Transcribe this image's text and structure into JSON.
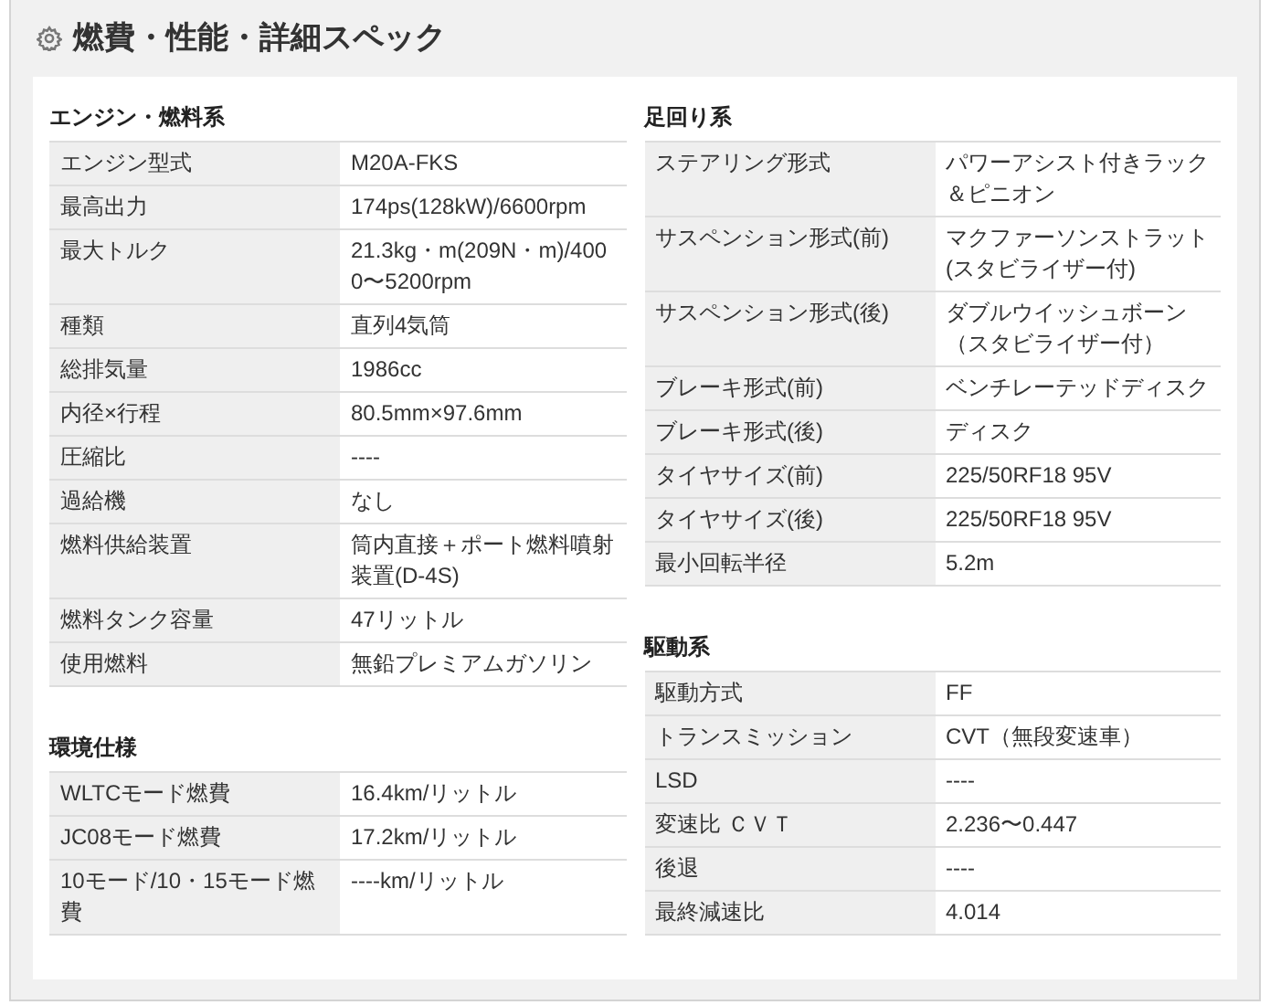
{
  "title": "燃費・性能・詳細スペック",
  "columns": [
    {
      "sections": [
        {
          "heading": "エンジン・燃料系",
          "rows": [
            {
              "label": "エンジン型式",
              "value": "M20A-FKS"
            },
            {
              "label": "最高出力",
              "value": "174ps(128kW)/6600rpm"
            },
            {
              "label": "最大トルク",
              "value": "21.3kg・m(209N・m)/4000〜5200rpm"
            },
            {
              "label": "種類",
              "value": "直列4気筒"
            },
            {
              "label": "総排気量",
              "value": "1986cc"
            },
            {
              "label": "内径×行程",
              "value": "80.5mm×97.6mm"
            },
            {
              "label": "圧縮比",
              "value": "----"
            },
            {
              "label": "過給機",
              "value": "なし"
            },
            {
              "label": "燃料供給装置",
              "value": "筒内直接＋ポート燃料噴射装置(D-4S)"
            },
            {
              "label": "燃料タンク容量",
              "value": "47リットル"
            },
            {
              "label": "使用燃料",
              "value": "無鉛プレミアムガソリン"
            }
          ]
        },
        {
          "heading": "環境仕様",
          "rows": [
            {
              "label": "WLTCモード燃費",
              "value": "16.4km/リットル"
            },
            {
              "label": "JC08モード燃費",
              "value": "17.2km/リットル"
            },
            {
              "label": "10モード/10・15モード燃費",
              "value": "----km/リットル"
            }
          ]
        }
      ]
    },
    {
      "sections": [
        {
          "heading": "足回り系",
          "rows": [
            {
              "label": "ステアリング形式",
              "value": "パワーアシスト付きラック＆ピニオン"
            },
            {
              "label": "サスペンション形式(前)",
              "value": "マクファーソンストラット(スタビライザー付)"
            },
            {
              "label": "サスペンション形式(後)",
              "value": "ダブルウイッシュボーン（スタビライザー付）"
            },
            {
              "label": "ブレーキ形式(前)",
              "value": "ベンチレーテッドディスク"
            },
            {
              "label": "ブレーキ形式(後)",
              "value": "ディスク"
            },
            {
              "label": "タイヤサイズ(前)",
              "value": "225/50RF18 95V"
            },
            {
              "label": "タイヤサイズ(後)",
              "value": "225/50RF18 95V"
            },
            {
              "label": "最小回転半径",
              "value": "5.2m"
            }
          ]
        },
        {
          "heading": "駆動系",
          "rows": [
            {
              "label": "駆動方式",
              "value": "FF"
            },
            {
              "label": "トランスミッション",
              "value": "CVT（無段変速車）"
            },
            {
              "label": "LSD",
              "value": "----"
            },
            {
              "label": "変速比 ＣＶＴ",
              "value": "2.236〜0.447"
            },
            {
              "label": "後退",
              "value": "----"
            },
            {
              "label": "最終減速比",
              "value": "4.014"
            }
          ]
        }
      ]
    }
  ]
}
